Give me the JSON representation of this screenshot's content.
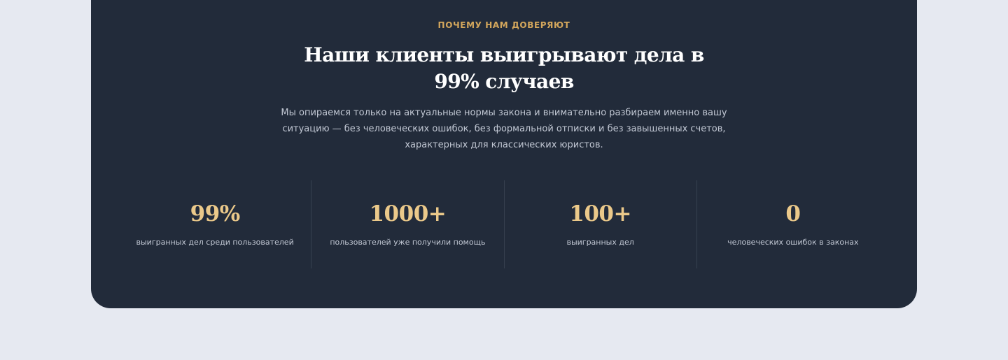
{
  "section": {
    "eyebrow": "ПОЧЕМУ НАМ ДОВЕРЯЮТ",
    "title": "Наши клиенты выигрывают дела в 99% случаев",
    "lead": "Мы опираемся только на актуальные нормы закона и внимательно разбираем именно вашу ситуацию — без человеческих ошибок, без формальной отписки и без завышенных счетов, характерных для классических юристов."
  },
  "stats": [
    {
      "value": "99%",
      "label": "выигранных дел среди пользователей"
    },
    {
      "value": "1000+",
      "label": "пользователей уже получили помощь"
    },
    {
      "value": "100+",
      "label": "выигранных дел"
    },
    {
      "value": "0",
      "label": "человеческих ошибок в законах"
    }
  ],
  "colors": {
    "page_background": "#e6e9f1",
    "panel_background": "#222b3a",
    "accent": "#d4a75c",
    "stat_value": "#ebc98a"
  }
}
